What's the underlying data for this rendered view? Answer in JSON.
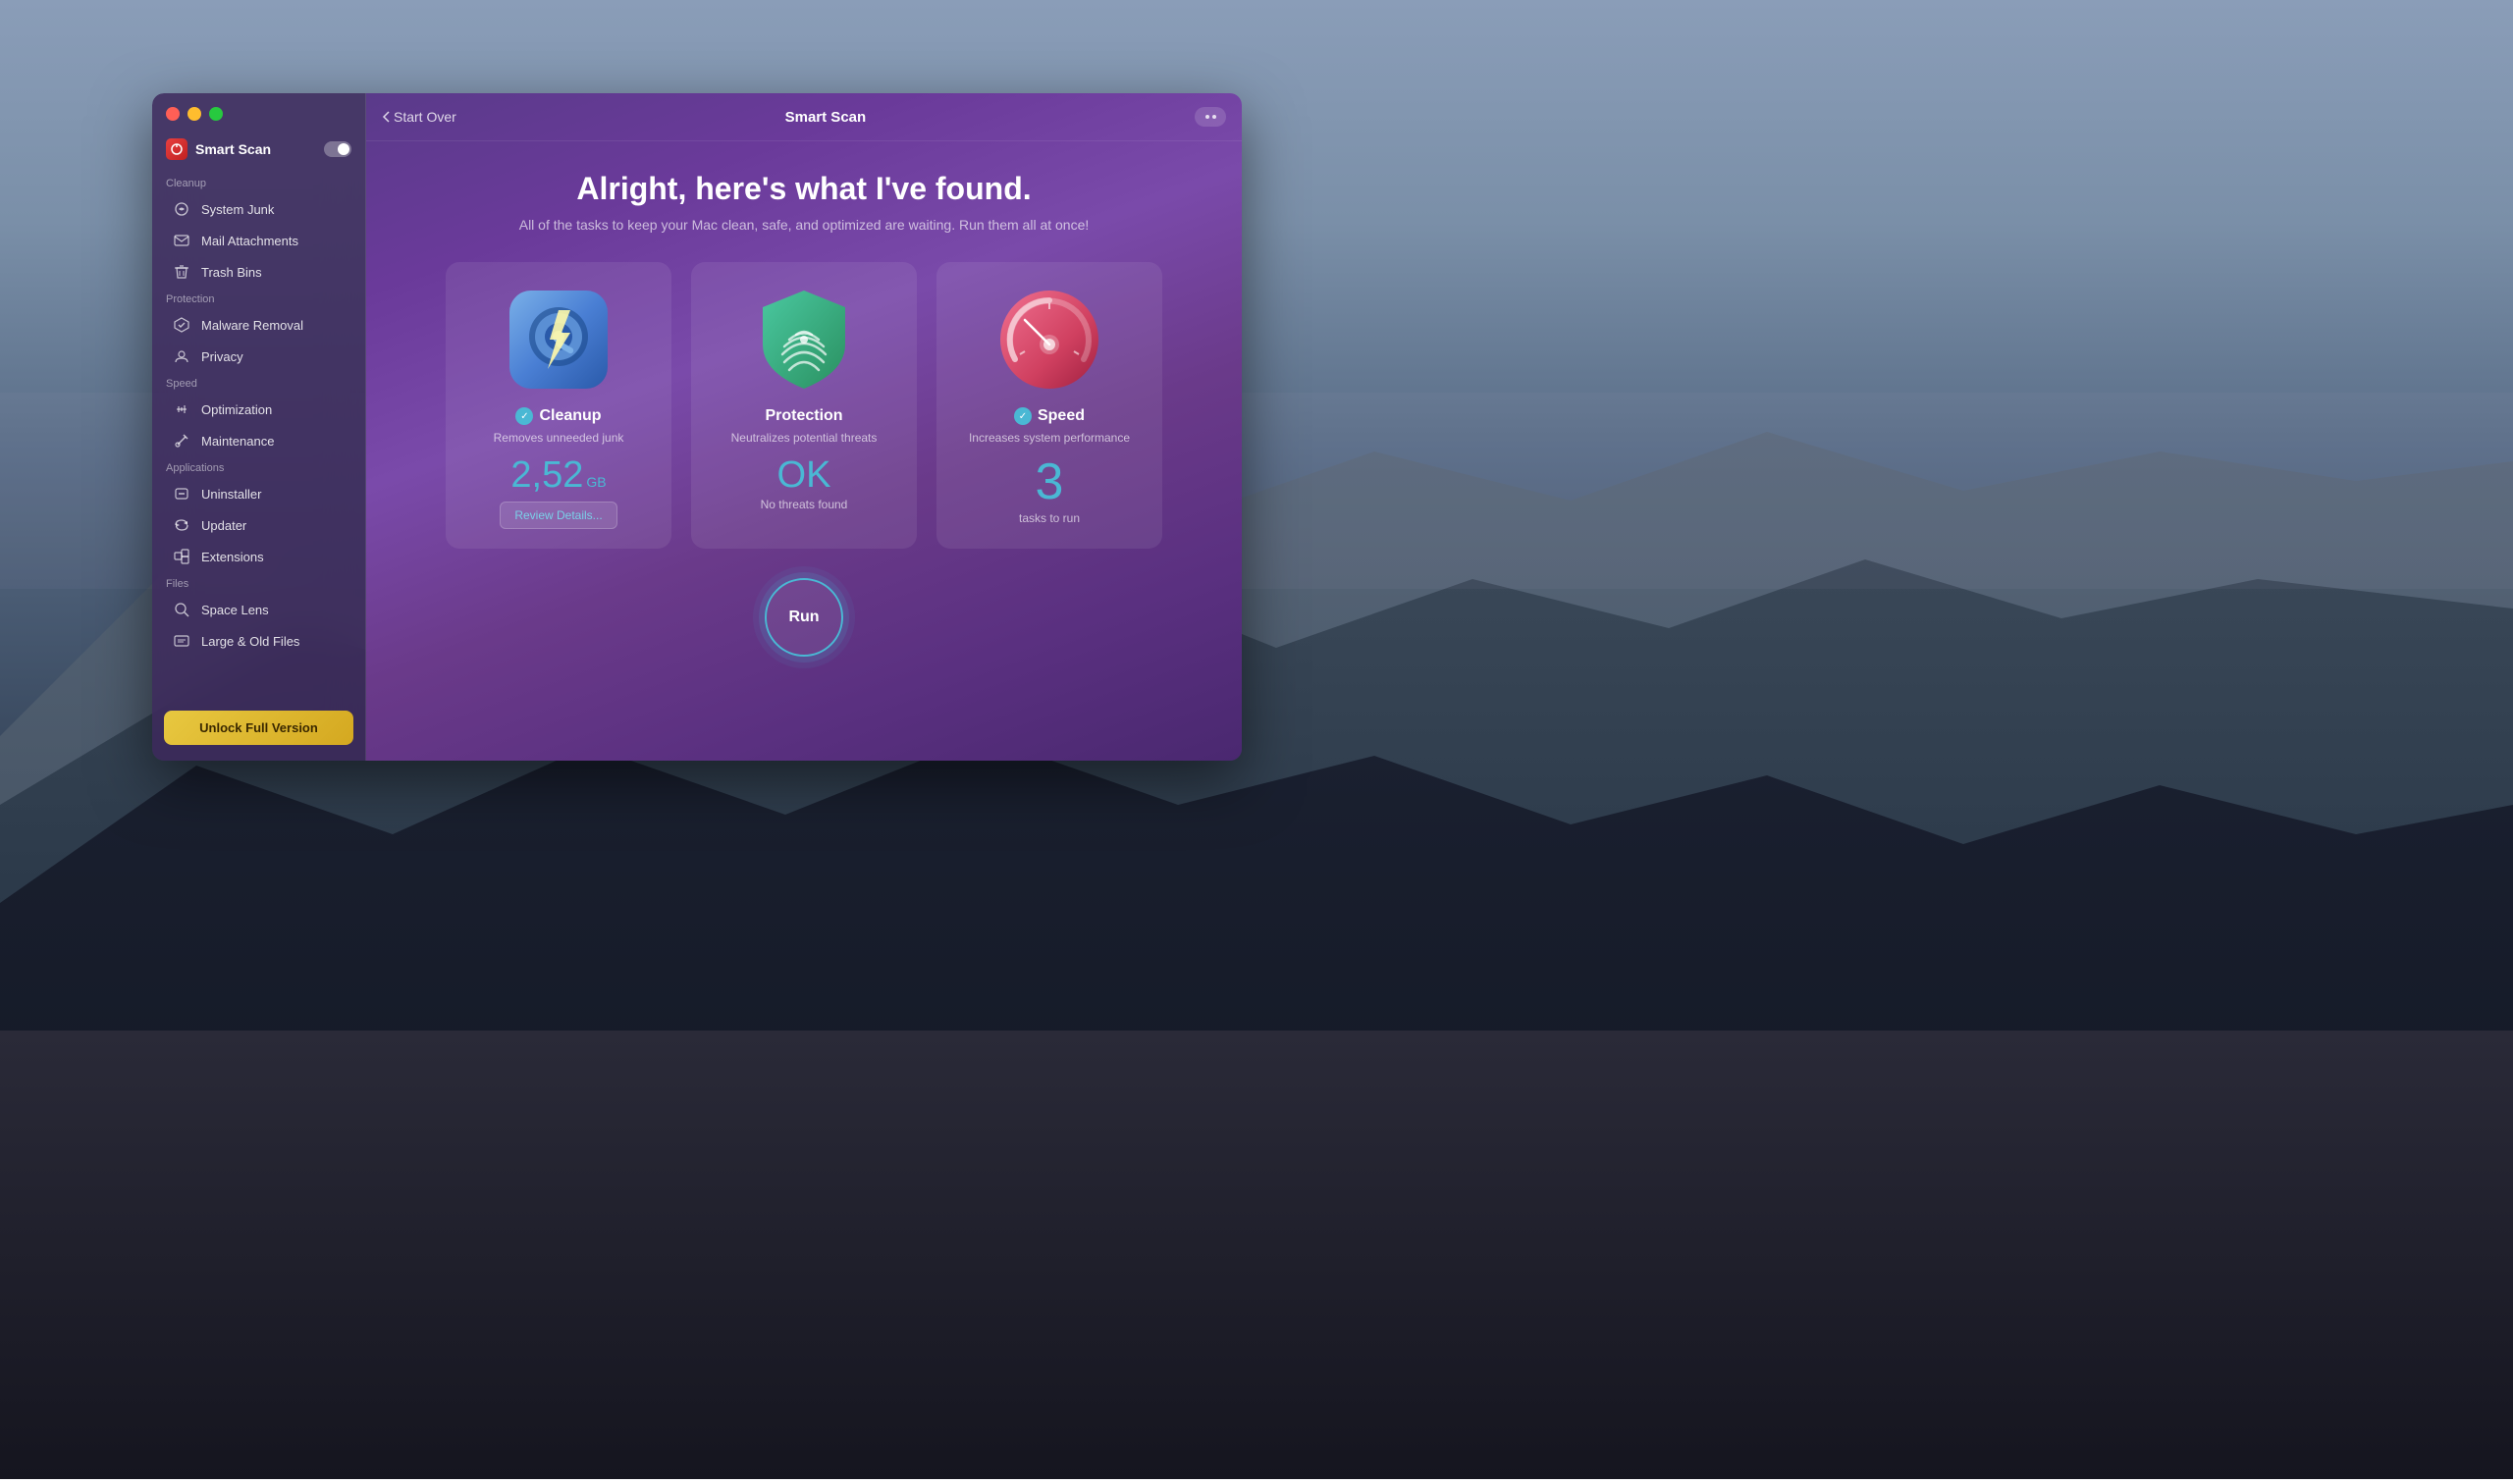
{
  "desktop": {
    "bg_description": "macOS mountain landscape background"
  },
  "window": {
    "title": "Smart Scan"
  },
  "traffic_lights": {
    "close": "●",
    "minimize": "●",
    "maximize": "●"
  },
  "sidebar": {
    "smart_scan_label": "Smart Scan",
    "sections": [
      {
        "label": "Cleanup",
        "items": [
          {
            "icon": "system-junk-icon",
            "label": "System Junk"
          },
          {
            "icon": "mail-icon",
            "label": "Mail Attachments"
          },
          {
            "icon": "trash-icon",
            "label": "Trash Bins"
          }
        ]
      },
      {
        "label": "Protection",
        "items": [
          {
            "icon": "malware-icon",
            "label": "Malware Removal"
          },
          {
            "icon": "privacy-icon",
            "label": "Privacy"
          }
        ]
      },
      {
        "label": "Speed",
        "items": [
          {
            "icon": "optimization-icon",
            "label": "Optimization"
          },
          {
            "icon": "maintenance-icon",
            "label": "Maintenance"
          }
        ]
      },
      {
        "label": "Applications",
        "items": [
          {
            "icon": "uninstaller-icon",
            "label": "Uninstaller"
          },
          {
            "icon": "updater-icon",
            "label": "Updater"
          },
          {
            "icon": "extensions-icon",
            "label": "Extensions"
          }
        ]
      },
      {
        "label": "Files",
        "items": [
          {
            "icon": "space-lens-icon",
            "label": "Space Lens"
          },
          {
            "icon": "large-old-icon",
            "label": "Large & Old Files"
          }
        ]
      }
    ],
    "unlock_btn_label": "Unlock Full Version"
  },
  "header": {
    "back_label": "Start Over",
    "title": "Smart Scan"
  },
  "main": {
    "title": "Alright, here's what I've found.",
    "subtitle": "All of the tasks to keep your Mac clean, safe, and optimized are waiting. Run them all at once!",
    "cards": [
      {
        "id": "cleanup",
        "name": "Cleanup",
        "desc": "Removes unneeded junk",
        "has_check": true,
        "value_num": "2,52",
        "value_unit": "GB",
        "action_label": "Review Details...",
        "ok_text": null,
        "ok_sub": null,
        "speed_num": null,
        "speed_sub": null
      },
      {
        "id": "protection",
        "name": "Protection",
        "desc": "Neutralizes potential threats",
        "has_check": false,
        "value_num": null,
        "value_unit": null,
        "action_label": null,
        "ok_text": "OK",
        "ok_sub": "No threats found",
        "speed_num": null,
        "speed_sub": null
      },
      {
        "id": "speed",
        "name": "Speed",
        "desc": "Increases system performance",
        "has_check": true,
        "value_num": null,
        "value_unit": null,
        "action_label": null,
        "ok_text": null,
        "ok_sub": null,
        "speed_num": "3",
        "speed_sub": "tasks to run"
      }
    ],
    "run_button_label": "Run"
  }
}
